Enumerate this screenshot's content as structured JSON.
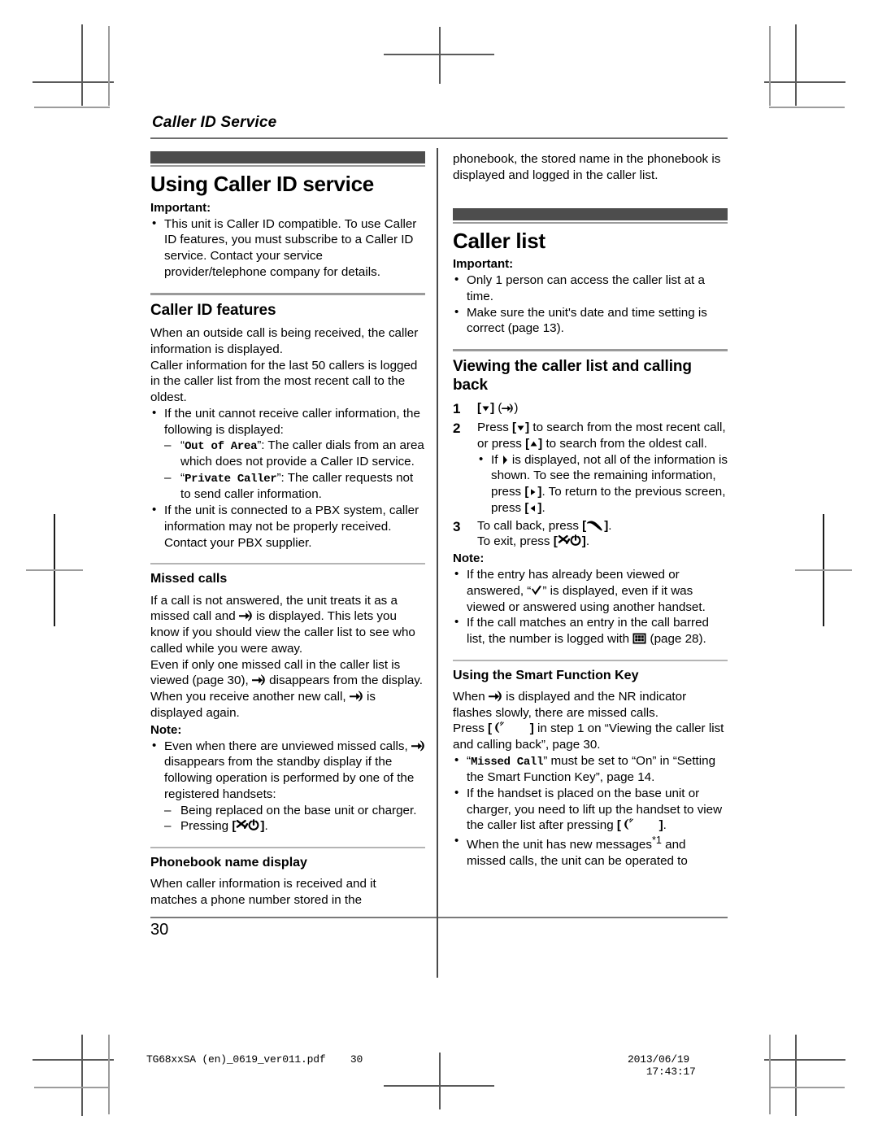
{
  "running_head": "Caller ID Service",
  "page_number": "30",
  "print_footer": {
    "file": "TG68xxSA (en)_0619_ver011.pdf",
    "page": "30",
    "date": "2013/06/19",
    "time": "17:43:17"
  },
  "colors": {
    "banner_bar": "#4d4d4d",
    "rule_light": "#9a9a9a",
    "rule_dark": "#6e6e6e",
    "column_divider": "#4a4a4a",
    "crop_mark": "#5a5a5a"
  },
  "icons": {
    "missed_call": "missed-call-icon",
    "power_off": "power-off-key-icon",
    "talk": "talk-key-icon",
    "smart_function": "smart-function-key-icon",
    "call_barred": "call-barred-icon",
    "check": "check-mark-icon",
    "nav_down": "down-arrow-key-icon",
    "nav_up": "up-arrow-key-icon",
    "nav_right": "right-arrow-key-icon",
    "nav_left": "left-arrow-key-icon"
  },
  "left_column": {
    "chapter_title": "Using Caller ID service",
    "important_label": "Important:",
    "important_items": [
      "This unit is Caller ID compatible. To use Caller ID features, you must subscribe to a Caller ID service. Contact your service provider/telephone company for details."
    ],
    "caller_id_features": {
      "heading": "Caller ID features",
      "para1": "When an outside call is being received, the caller information is displayed.",
      "para2": "Caller information for the last 50 callers is logged in the caller list from the most recent call to the oldest.",
      "bullet1_intro": "If the unit cannot receive caller information, the following is displayed:",
      "dash1_code": "Out of Area",
      "dash1_text": ": The caller dials from an area which does not provide a Caller ID service.",
      "dash2_code": "Private Caller",
      "dash2_text": ": The caller requests not to send caller information.",
      "bullet2": "If the unit is connected to a PBX system, caller information may not be properly received. Contact your PBX supplier."
    },
    "missed_calls": {
      "heading": "Missed calls",
      "para1_a": "If a call is not answered, the unit treats it as a missed call and ",
      "para1_b": " is displayed. This lets you know if you should view the caller list to see who called while you were away.",
      "para2_a": "Even if only one missed call in the caller list is viewed (page 30), ",
      "para2_b": " disappears from the display. When you receive another new call, ",
      "para2_c": " is displayed again.",
      "note_label": "Note:",
      "note_a": "Even when there are unviewed missed calls, ",
      "note_b": " disappears from the standby display if the following operation is performed by one of the registered handsets:",
      "note_dash1": "Being replaced on the base unit or charger.",
      "note_dash2_pre": "Pressing ",
      "note_dash2_post": "."
    },
    "phonebook_name_display": {
      "heading": "Phonebook name display",
      "para": "When caller information is received and it matches a phone number stored in the"
    }
  },
  "right_column": {
    "continuation": "phonebook, the stored name in the phonebook is displayed and logged in the caller list.",
    "chapter_title": "Caller list",
    "important_label": "Important:",
    "important_items": [
      "Only 1 person can access the caller list at a time.",
      "Make sure the unit's date and time setting is correct (page 13)."
    ],
    "viewing": {
      "heading": "Viewing the caller list and calling back",
      "step1_num": "1",
      "step2_num": "2",
      "step3_num": "3",
      "step2_text_a": "Press ",
      "step2_text_b": " to search from the most recent call, or press ",
      "step2_text_c": " to search from the oldest call.",
      "step2_bullet_a": "If ",
      "step2_bullet_b": " is displayed, not all of the information is shown. To see the remaining information, press ",
      "step2_bullet_c": ". To return to the previous screen, press ",
      "step2_bullet_d": ".",
      "step3_a": "To call back, press ",
      "step3_b": ".",
      "step3_c": "To exit, press ",
      "step3_d": "."
    },
    "note_label": "Note:",
    "notes": [
      {
        "a": "If the entry has already been viewed or answered, “",
        "b": "” is displayed, even if it was viewed or answered using another handset."
      },
      {
        "a": "If the call matches an entry in the call barred list, the number is logged with ",
        "b": " (page 28)."
      }
    ],
    "smart_function_key": {
      "heading": "Using the Smart Function Key",
      "para1_a": "When ",
      "para1_b": " is displayed and the NR indicator flashes slowly, there are missed calls.",
      "para2_a": "Press ",
      "para2_b": " in step 1 on “Viewing the caller list and calling back”, page 30.",
      "bullet1_code": "Missed Call",
      "bullet1_text_a": "” must be set to “On” in “Setting the Smart Function Key”, page 14.",
      "bullet2_a": "If the handset is placed on the base unit or charger, you need to lift up the handset to view the caller list after pressing ",
      "bullet2_b": ".",
      "bullet3_a": "When the unit has new messages",
      "bullet3_sup": "*1",
      "bullet3_b": " and missed calls, the unit can be operated to"
    }
  }
}
